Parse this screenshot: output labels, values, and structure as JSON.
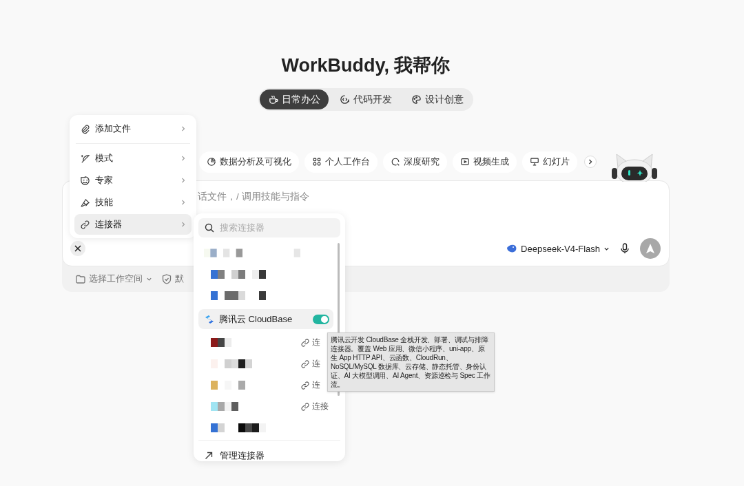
{
  "title": "WorkBuddy, 我帮你",
  "mode_tabs": [
    {
      "label": "日常办公",
      "selected": true
    },
    {
      "label": "代码开发",
      "selected": false
    },
    {
      "label": "设计创意",
      "selected": false
    }
  ],
  "quick_chips": [
    {
      "label": "数据分析及可视化"
    },
    {
      "label": "个人工作台"
    },
    {
      "label": "深度研究"
    },
    {
      "label": "视频生成"
    },
    {
      "label": "幻灯片"
    }
  ],
  "composer": {
    "placeholder": "话文件，/ 调用技能与指令",
    "model": "Deepseek-V4-Flash"
  },
  "footer": {
    "workspace": "选择工作空间",
    "policy": "默"
  },
  "attach_menu": {
    "items": [
      {
        "label": "添加文件",
        "selected": false
      },
      {
        "label": "模式",
        "selected": false
      },
      {
        "label": "专家",
        "selected": false
      },
      {
        "label": "技能",
        "selected": false
      },
      {
        "label": "连接器",
        "selected": true
      }
    ]
  },
  "connector_panel": {
    "search_placeholder": "搜索连接器",
    "items": [
      {
        "kind": "hidden"
      },
      {
        "kind": "hidden"
      },
      {
        "kind": "hidden"
      },
      {
        "kind": "connector",
        "name": "腾讯云 CloudBase",
        "on": true
      },
      {
        "kind": "hidden",
        "action": "连"
      },
      {
        "kind": "hidden",
        "action": "连"
      },
      {
        "kind": "hidden",
        "action": "连"
      },
      {
        "kind": "hidden",
        "action": "连接"
      },
      {
        "kind": "hidden"
      }
    ],
    "manage": "管理连接器"
  },
  "tooltip": {
    "text": "腾讯云开发 CloudBase 全栈开发、部署、调试与排障连接器。覆盖 Web 应用、微信小程序、uni-app、原生 App HTTP API、云函数、CloudRun、NoSQL/MySQL 数据库、云存储、静态托管、身份认证、AI 大模型调用、AI Agent、资源巡检与 Spec 工作流。"
  }
}
